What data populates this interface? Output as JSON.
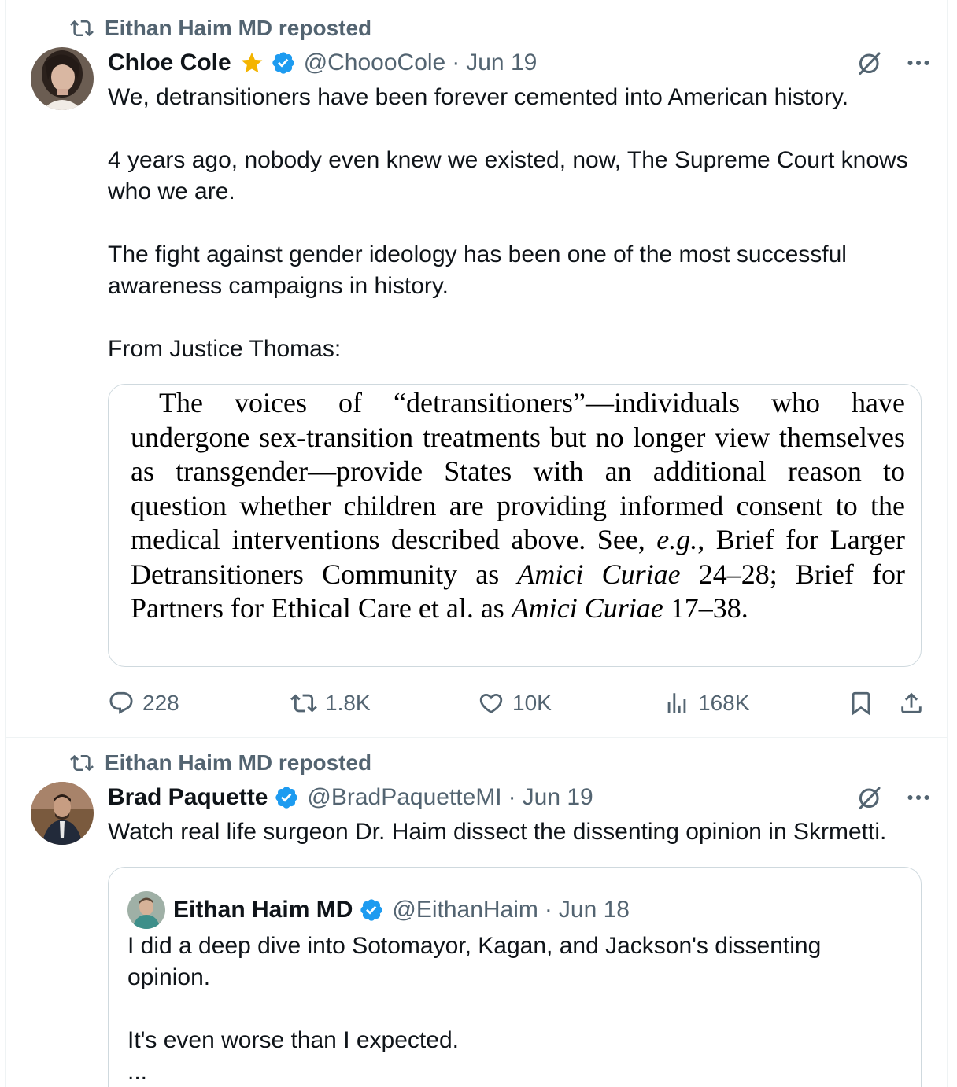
{
  "colors": {
    "accent": "#1d9bf0",
    "secondary_text": "#536471",
    "gold_star": "#f4b400",
    "border": "#cfd9de"
  },
  "tweet1": {
    "repost_label": "Eithan Haim MD reposted",
    "author_name": "Chloe Cole",
    "handle": "@ChoooCole",
    "dot": "·",
    "date": "Jun 19",
    "paragraphs": [
      "We, detransitioners have been forever cemented into American history.",
      "4 years ago, nobody even knew we existed, now, The Supreme Court knows who we are.",
      "The fight against gender ideology has been one of the most successful awareness campaigns in history.",
      "From Justice Thomas:"
    ],
    "quote_image_text": "The voices of “detransitioners”—individuals who have undergone sex-transition treatments but no longer view themselves as transgender—provide States with an addi- tional reason to question whether children are providing in- formed consent to the medical interventions described above. See, e.g., Brief for Larger Detransitioners Commu- nity as Amici Curiae 24–28; Brief for Partners for Ethical Care et al. as Amici Curiae 17–38.",
    "quote_parts": {
      "a": "The voices of “detransitioners”—individuals who have undergone sex-transition treatments but no longer view themselves as transgender—provide States with an addi­tional reason to question whether children are providing in­formed consent to the medical interventions described above.  See, ",
      "eg": "e.g.",
      "b": ", Brief for Larger Detransitioners Commu­nity as ",
      "amici1": "Amici Curiae",
      "c": " 24–28; Brief for Partners for Ethical Care et al. as ",
      "amici2": "Amici Curiae",
      "d": " 17–38."
    },
    "stats": {
      "replies": "228",
      "reposts": "1.8K",
      "likes": "10K",
      "views": "168K"
    }
  },
  "tweet2": {
    "repost_label": "Eithan Haim MD reposted",
    "author_name": "Brad Paquette",
    "handle": "@BradPaquetteMI",
    "dot": "·",
    "date": "Jun 19",
    "text": "Watch real life surgeon Dr. Haim dissect the dissenting opinion in Skrmetti.",
    "quoted": {
      "author_name": "Eithan Haim MD",
      "handle": "@EithanHaim",
      "dot": "·",
      "date": "Jun 18",
      "paragraphs": [
        "I did a deep dive into Sotomayor, Kagan, and Jackson's dissenting opinion.",
        "It's even worse than I expected.",
        "..."
      ]
    }
  },
  "icons": [
    "repost-icon",
    "verified-badge-icon",
    "gold-star-icon",
    "grok-icon",
    "more-icon",
    "reply-icon",
    "like-icon",
    "views-icon",
    "bookmark-icon",
    "share-icon"
  ]
}
